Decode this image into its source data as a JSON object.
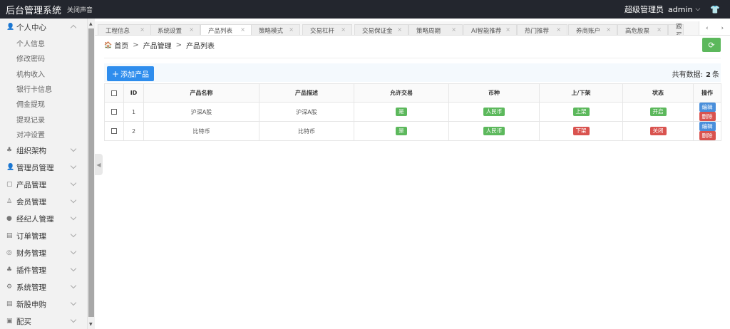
{
  "topbar": {
    "brand": "后台管理系统",
    "sound": "关闭声音",
    "role": "超级管理员",
    "user": "admin",
    "dropdown_icon": "chevron-down-icon",
    "shirt_icon": "tshirt-icon"
  },
  "sidebar": [
    {
      "label": "个人中心",
      "icon": "user-icon",
      "open": true,
      "children": [
        "个人信息",
        "修改密码",
        "机构收入",
        "银行卡信息",
        "佣金提现",
        "提现记录",
        "对冲设置"
      ]
    },
    {
      "label": "组织架构",
      "icon": "org-icon"
    },
    {
      "label": "管理员管理",
      "icon": "admin-icon"
    },
    {
      "label": "产品管理",
      "icon": "product-icon"
    },
    {
      "label": "会员管理",
      "icon": "member-icon"
    },
    {
      "label": "经纪人管理",
      "icon": "broker-icon"
    },
    {
      "label": "订单管理",
      "icon": "order-icon"
    },
    {
      "label": "财务管理",
      "icon": "finance-icon"
    },
    {
      "label": "插件管理",
      "icon": "plugin-icon"
    },
    {
      "label": "系统管理",
      "icon": "system-icon"
    },
    {
      "label": "新股申购",
      "icon": "ipo-icon"
    },
    {
      "label": "配买",
      "icon": "buy-icon"
    }
  ],
  "tabs": [
    "工程信息",
    "系统设置",
    "产品列表",
    "策略模式",
    "交易杠杆",
    "交易保证金",
    "策略周期",
    "AI智能推荐",
    "热门推荐",
    "券商账户",
    "高危股票",
    "跟买"
  ],
  "active_tab": "产品列表",
  "breadcrumb": {
    "home": "首页",
    "level1": "产品管理",
    "level2": "产品列表"
  },
  "toolbar": {
    "add_label": "添加产品",
    "count_prefix": "共有数据:",
    "count_value": "2",
    "count_unit": "条"
  },
  "table": {
    "headers": [
      "ID",
      "产品名称",
      "产品描述",
      "允许交易",
      "币种",
      "上/下架",
      "状态",
      "操作"
    ],
    "rows": [
      {
        "id": "1",
        "name": "沪深A股",
        "desc": "沪深A股",
        "trade": "是",
        "currency": "人民币",
        "shelf": "上架",
        "status": "开启",
        "edit": "编辑",
        "delete": "删除"
      },
      {
        "id": "2",
        "name": "比特币",
        "desc": "比特币",
        "trade": "是",
        "currency": "人民币",
        "shelf": "下架",
        "status": "关闭",
        "edit": "编辑",
        "delete": "删除"
      }
    ]
  },
  "colors": {
    "topbar": "#23262e",
    "primary": "#2e8ded",
    "success": "#5cb85c",
    "danger": "#d9534f"
  }
}
